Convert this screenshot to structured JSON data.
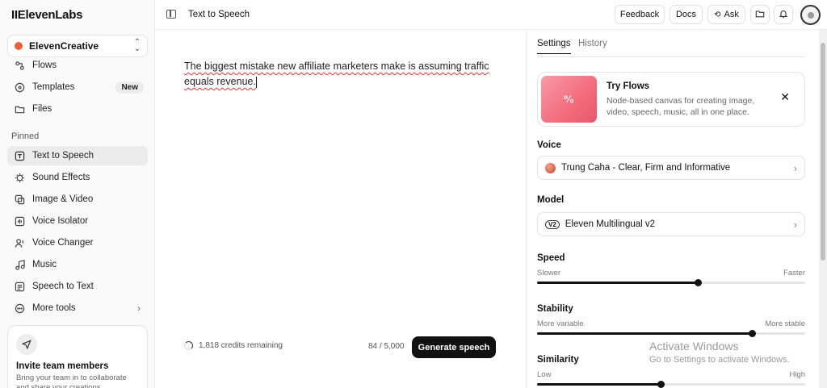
{
  "app": {
    "logo": "IIElevenLabs"
  },
  "sidebar": {
    "workspace": "ElevenCreative",
    "items_top": [
      {
        "label": "Flows",
        "icon": "flows-icon"
      },
      {
        "label": "Templates",
        "icon": "templates-icon",
        "badge": "New"
      },
      {
        "label": "Files",
        "icon": "files-icon"
      }
    ],
    "pinned_label": "Pinned",
    "items_pinned": [
      {
        "label": "Text to Speech",
        "icon": "text-to-speech-icon",
        "active": true
      },
      {
        "label": "Sound Effects",
        "icon": "sound-effects-icon"
      },
      {
        "label": "Image & Video",
        "icon": "image-video-icon"
      },
      {
        "label": "Voice Isolator",
        "icon": "voice-isolator-icon"
      },
      {
        "label": "Voice Changer",
        "icon": "voice-changer-icon"
      },
      {
        "label": "Music",
        "icon": "music-icon"
      },
      {
        "label": "Speech to Text",
        "icon": "speech-to-text-icon"
      },
      {
        "label": "More tools",
        "icon": "more-tools-icon"
      }
    ],
    "invite": {
      "title": "Invite team members",
      "desc": "Bring your team in to collaborate and share your creations."
    }
  },
  "topbar": {
    "title": "Text to Speech",
    "feedback": "Feedback",
    "docs": "Docs",
    "ask": "Ask"
  },
  "editor": {
    "text": "The biggest mistake new affiliate marketers make is assuming traffic equals revenue.",
    "credits": "1,818 credits remaining",
    "char_count": "84 / 5,000",
    "generate": "Generate speech"
  },
  "settings": {
    "tabs": [
      "Settings",
      "History"
    ],
    "promo": {
      "title": "Try Flows",
      "desc": "Node-based canvas for creating image, video, speech, music, all in one place."
    },
    "voice_label": "Voice",
    "voice_value": "Trung Caha - Clear, Firm and Informative",
    "model_label": "Model",
    "model_badge": "V2",
    "model_value": "Eleven Multilingual v2",
    "speed": {
      "label": "Speed",
      "min": "Slower",
      "max": "Faster",
      "value": 0.6
    },
    "stability": {
      "label": "Stability",
      "min": "More variable",
      "max": "More stable",
      "value": 0.8
    },
    "similarity": {
      "label": "Similarity",
      "min": "Low",
      "max": "High",
      "value": 0.46
    }
  },
  "watermark": {
    "line1": "Activate Windows",
    "line2": "Go to Settings to activate Windows."
  }
}
